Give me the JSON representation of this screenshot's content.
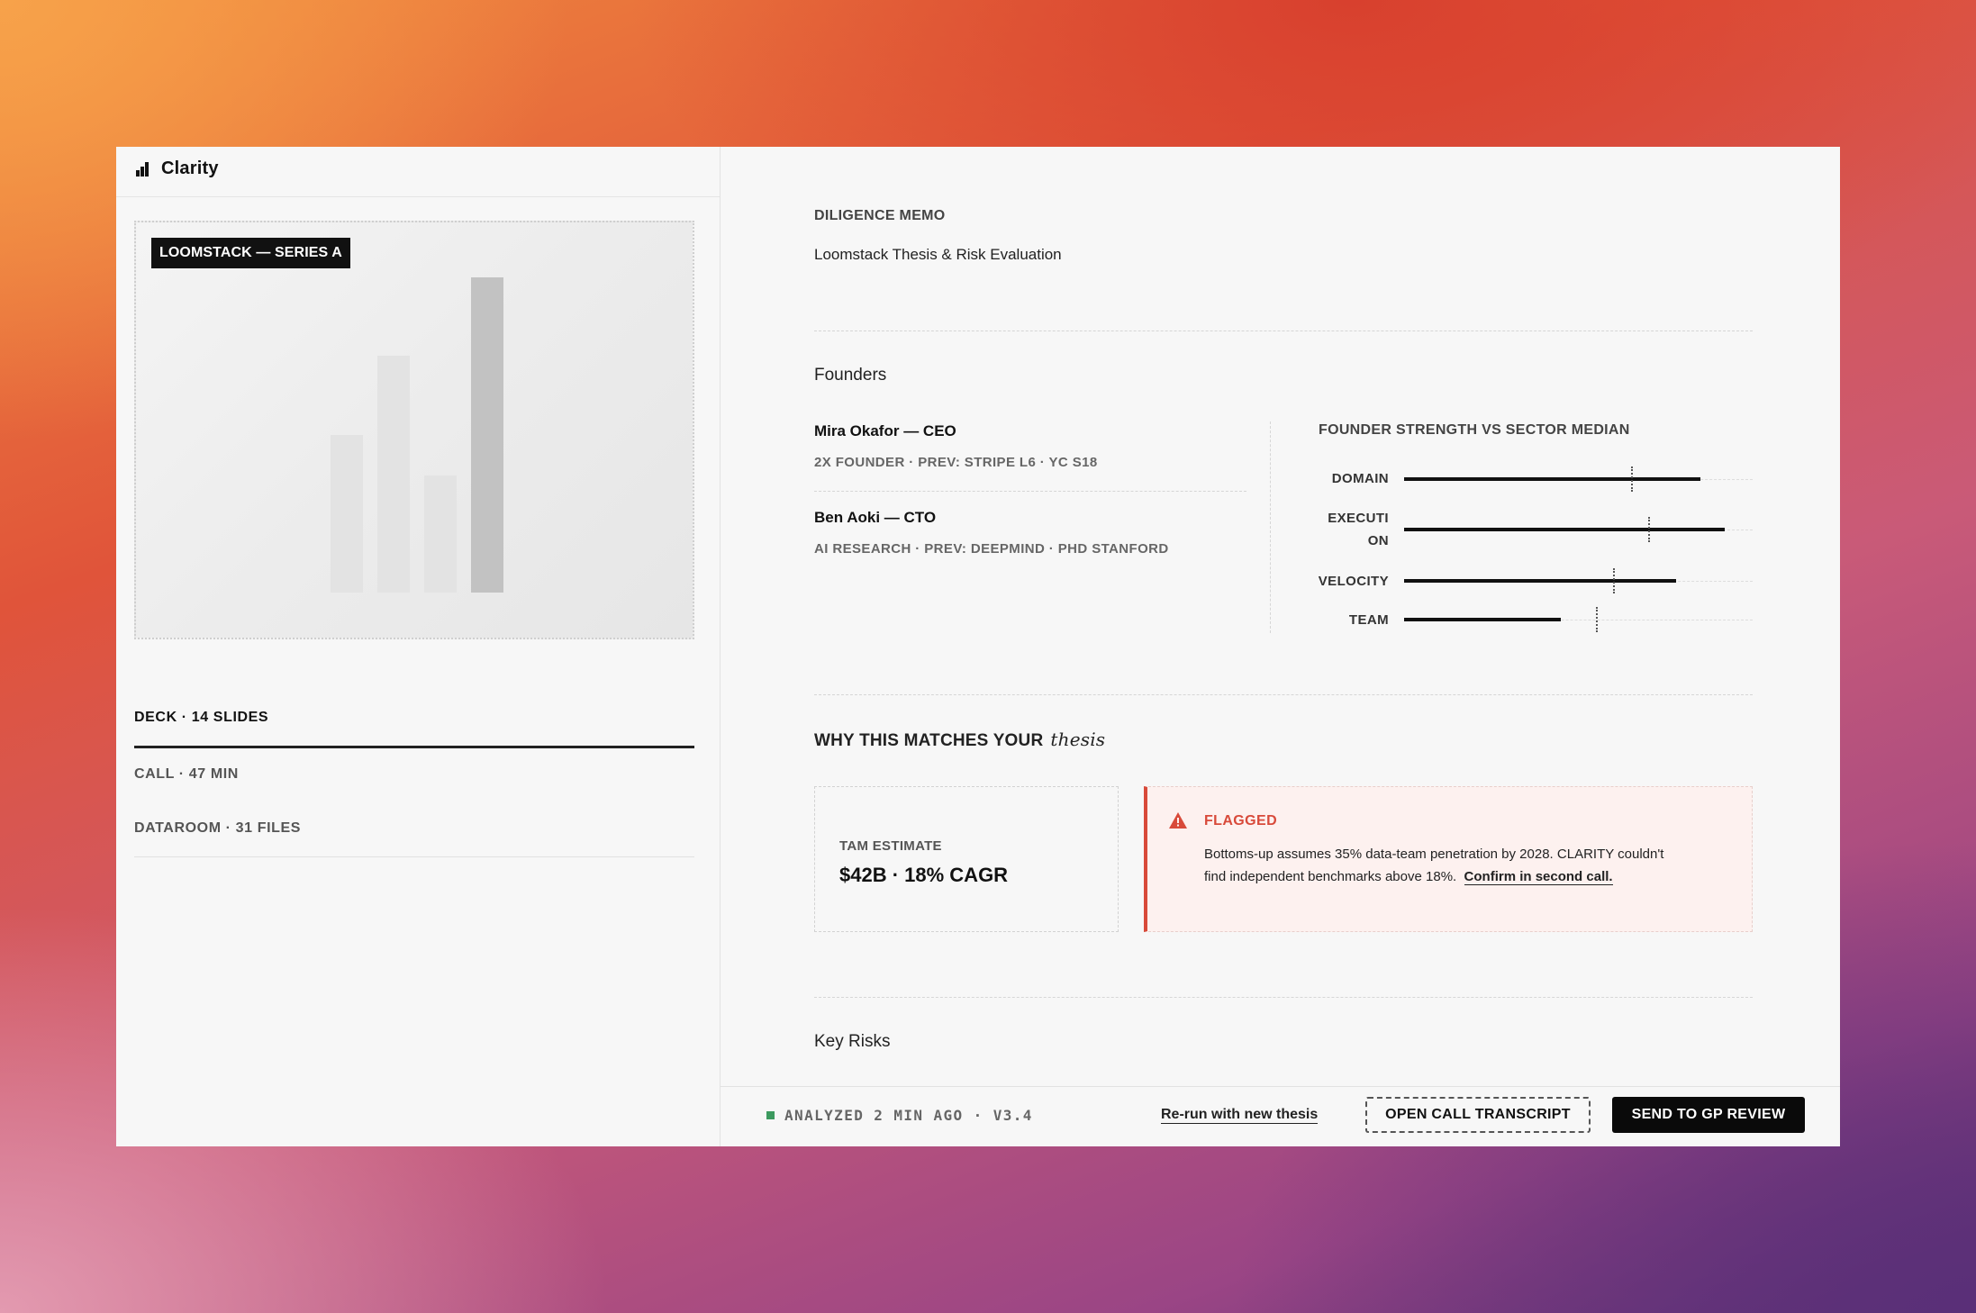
{
  "app": {
    "title": "Clarity",
    "icon": "bar-chart-icon"
  },
  "preview": {
    "badge": "LOOMSTACK — SERIES A",
    "bars": [
      0.5,
      0.75,
      0.37,
      1.0
    ]
  },
  "tabs": [
    {
      "label": "DECK · 14 SLIDES",
      "active": true
    },
    {
      "label": "CALL · 47 MIN",
      "active": false
    },
    {
      "label": "DATAROOM · 31 FILES",
      "active": false
    }
  ],
  "memo": {
    "eyebrow": "DILIGENCE MEMO",
    "title": "Loomstack Thesis & Risk Evaluation"
  },
  "founders": {
    "heading": "Founders",
    "people": [
      {
        "name": "Mira Okafor — CEO",
        "meta": "2X FOUNDER · PREV: STRIPE L6 · YC S18"
      },
      {
        "name": "Ben Aoki — CTO",
        "meta": "AI RESEARCH · PREV: DEEPMIND · PHD STANFORD"
      }
    ],
    "strength": {
      "title": "FOUNDER STRENGTH VS SECTOR MEDIAN",
      "metrics": [
        {
          "label_lines": [
            "DOMAIN"
          ],
          "value": 0.85,
          "median": 0.65
        },
        {
          "label_lines": [
            "EXECUTI",
            "ON"
          ],
          "value": 0.92,
          "median": 0.7
        },
        {
          "label_lines": [
            "VELOCITY"
          ],
          "value": 0.78,
          "median": 0.6
        },
        {
          "label_lines": [
            "TEAM"
          ],
          "value": 0.45,
          "median": 0.55
        }
      ]
    }
  },
  "thesis": {
    "heading": "WHY THIS MATCHES YOUR",
    "heading_em": "thesis",
    "tam": {
      "label": "TAM ESTIMATE",
      "value": "$42B · 18% CAGR"
    },
    "flag": {
      "icon": "warning-icon",
      "title": "FLAGGED",
      "body": "Bottoms-up assumes 35% data-team penetration by 2028. CLARITY couldn't find independent benchmarks above 18%.",
      "link": "Confirm in second call."
    }
  },
  "risks": {
    "heading": "Key Risks"
  },
  "footer": {
    "status": "ANALYZED 2 MIN AGO · V3.4",
    "rerun": "Re-run with new thesis",
    "open_transcript": "OPEN CALL TRANSCRIPT",
    "send_review": "SEND TO GP REVIEW"
  },
  "colors": {
    "accent_red": "#d84a3a",
    "status_green": "#3c9a5f",
    "dark": "#0a0a0a"
  }
}
